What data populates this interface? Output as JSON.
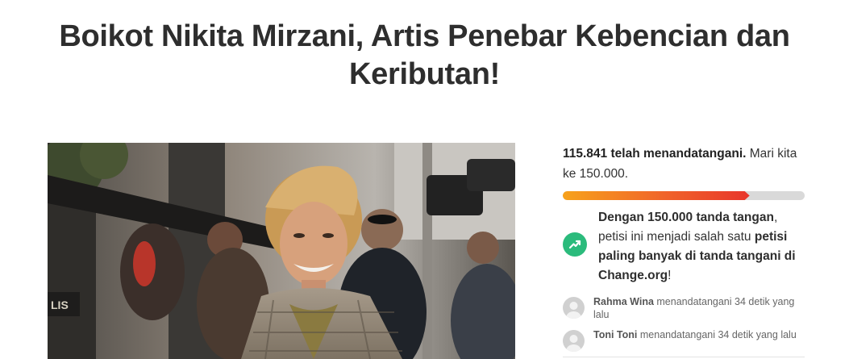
{
  "petition": {
    "title": "Boikot Nikita Mirzani, Artis Penebar Kebencian dan Keributan!"
  },
  "signatures": {
    "count_text": "115.841 telah menandatangani.",
    "goal_text": "Mari kita ke 150.000.",
    "progress_fraction": 0.7723
  },
  "milestone": {
    "strong_text": "Dengan 150.000 tanda tangan",
    "mid_text": ", petisi ini menjadi salah satu ",
    "strong_text2": "petisi paling banyak di tanda tangani di Change.org",
    "end_text": "!",
    "icon": "trending-up-icon"
  },
  "recent_signers": [
    {
      "name": "Rahma Wina",
      "action": "menandatangani 34 detik yang lalu"
    },
    {
      "name": "Toni Toni",
      "action": "menandatangani 34 detik yang lalu"
    }
  ],
  "colors": {
    "progress_start": "#f7a21b",
    "progress_end": "#e8352b",
    "milestone_icon": "#2bbb7c",
    "progress_track": "#d9d9d9"
  }
}
